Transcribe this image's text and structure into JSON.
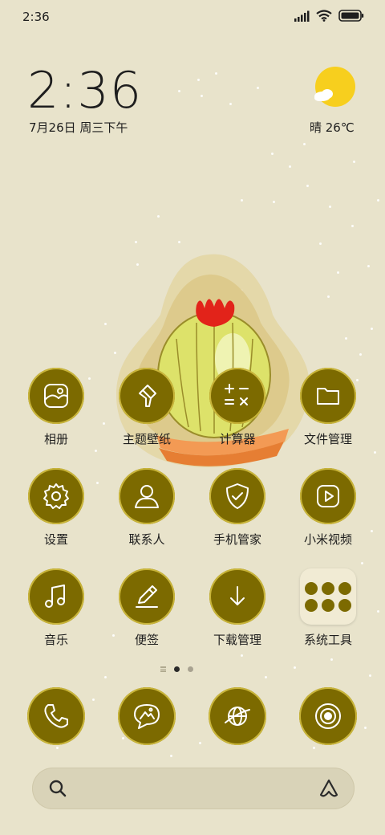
{
  "status": {
    "time": "2:36"
  },
  "clock": {
    "time": "2:36",
    "date": "7月26日 周三下午"
  },
  "weather": {
    "text": "晴 26℃"
  },
  "apps": [
    {
      "label": "相册",
      "icon": "gallery-icon"
    },
    {
      "label": "主题壁纸",
      "icon": "brush-icon"
    },
    {
      "label": "计算器",
      "icon": "calculator-icon"
    },
    {
      "label": "文件管理",
      "icon": "folder-icon"
    },
    {
      "label": "设置",
      "icon": "gear-icon"
    },
    {
      "label": "联系人",
      "icon": "person-icon"
    },
    {
      "label": "手机管家",
      "icon": "shield-icon"
    },
    {
      "label": "小米视频",
      "icon": "play-icon"
    },
    {
      "label": "音乐",
      "icon": "music-note-icon"
    },
    {
      "label": "便签",
      "icon": "pen-icon"
    },
    {
      "label": "下载管理",
      "icon": "download-icon"
    },
    {
      "label": "系统工具",
      "icon": "folder-tools-icon"
    }
  ],
  "dock": [
    {
      "icon": "phone-icon"
    },
    {
      "icon": "message-icon"
    },
    {
      "icon": "browser-icon"
    },
    {
      "icon": "camera-icon"
    }
  ],
  "colors": {
    "background": "#e8e3cb",
    "icon_fill": "#7c6a00",
    "sun": "#f7cf1e"
  }
}
